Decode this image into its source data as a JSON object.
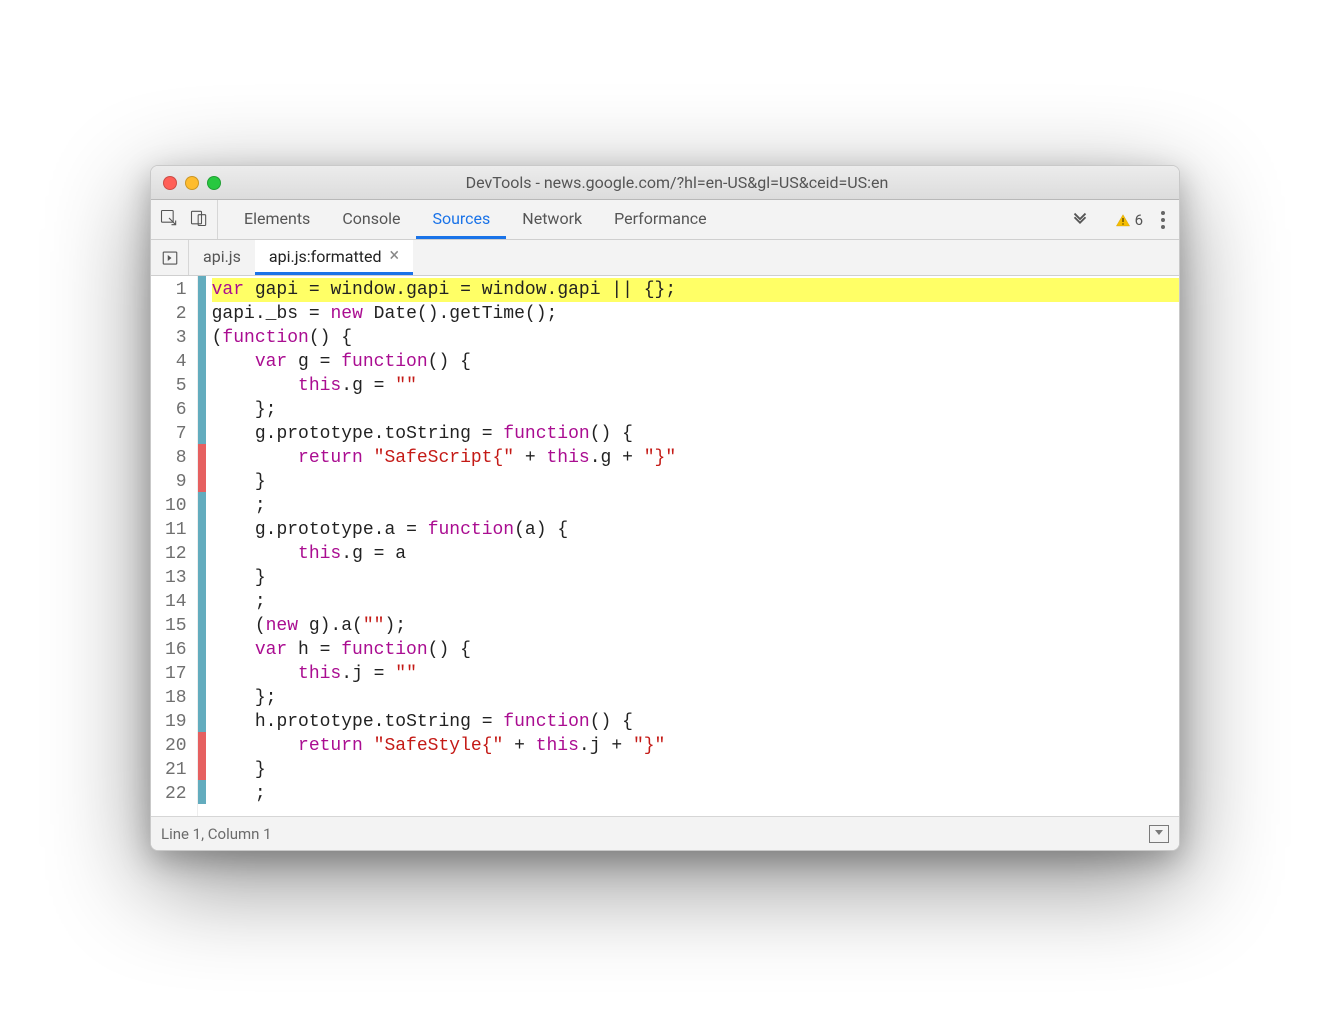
{
  "window": {
    "title": "DevTools - news.google.com/?hl=en-US&gl=US&ceid=US:en"
  },
  "toolbar": {
    "tabs": [
      "Elements",
      "Console",
      "Sources",
      "Network",
      "Performance"
    ],
    "active_tab_index": 2,
    "warning_count": "6"
  },
  "filetabs": {
    "items": [
      {
        "label": "api.js",
        "closable": false
      },
      {
        "label": "api.js:formatted",
        "closable": true
      }
    ],
    "active_index": 1
  },
  "code": {
    "lines": [
      {
        "n": 1,
        "cov": "b",
        "hl": true,
        "tokens": [
          [
            "kw",
            "var"
          ],
          [
            "pun",
            " gapi "
          ],
          [
            "pun",
            "= "
          ],
          [
            "pun",
            "window"
          ],
          [
            "pun",
            "."
          ],
          [
            "pun",
            "gapi "
          ],
          [
            "pun",
            "= "
          ],
          [
            "pun",
            "window"
          ],
          [
            "pun",
            "."
          ],
          [
            "pun",
            "gapi "
          ],
          [
            "pun",
            "|| "
          ],
          [
            "pun",
            "{};"
          ]
        ]
      },
      {
        "n": 2,
        "cov": "b",
        "tokens": [
          [
            "pun",
            "gapi"
          ],
          [
            "pun",
            "."
          ],
          [
            "pun",
            "_bs "
          ],
          [
            "pun",
            "= "
          ],
          [
            "kw",
            "new"
          ],
          [
            "pun",
            " Date"
          ],
          [
            "pun",
            "()."
          ],
          [
            "pun",
            "getTime"
          ],
          [
            "pun",
            "();"
          ]
        ]
      },
      {
        "n": 3,
        "cov": "b",
        "tokens": [
          [
            "pun",
            "("
          ],
          [
            "kw",
            "function"
          ],
          [
            "pun",
            "() {"
          ]
        ]
      },
      {
        "n": 4,
        "cov": "b",
        "tokens": [
          [
            "pun",
            "    "
          ],
          [
            "kw",
            "var"
          ],
          [
            "pun",
            " g "
          ],
          [
            "pun",
            "= "
          ],
          [
            "kw",
            "function"
          ],
          [
            "pun",
            "() {"
          ]
        ]
      },
      {
        "n": 5,
        "cov": "b",
        "tokens": [
          [
            "pun",
            "        "
          ],
          [
            "kw",
            "this"
          ],
          [
            "pun",
            "."
          ],
          [
            "pun",
            "g "
          ],
          [
            "pun",
            "= "
          ],
          [
            "str",
            "\"\""
          ]
        ]
      },
      {
        "n": 6,
        "cov": "b",
        "tokens": [
          [
            "pun",
            "    };"
          ]
        ]
      },
      {
        "n": 7,
        "cov": "b",
        "tokens": [
          [
            "pun",
            "    g"
          ],
          [
            "pun",
            "."
          ],
          [
            "pun",
            "prototype"
          ],
          [
            "pun",
            "."
          ],
          [
            "pun",
            "toString "
          ],
          [
            "pun",
            "= "
          ],
          [
            "kw",
            "function"
          ],
          [
            "pun",
            "() {"
          ]
        ]
      },
      {
        "n": 8,
        "cov": "r",
        "tokens": [
          [
            "pun",
            "        "
          ],
          [
            "kw",
            "return"
          ],
          [
            "pun",
            " "
          ],
          [
            "str",
            "\"SafeScript{\""
          ],
          [
            "pun",
            " + "
          ],
          [
            "kw",
            "this"
          ],
          [
            "pun",
            "."
          ],
          [
            "pun",
            "g "
          ],
          [
            "pun",
            "+ "
          ],
          [
            "str",
            "\"}\""
          ]
        ]
      },
      {
        "n": 9,
        "cov": "r",
        "tokens": [
          [
            "pun",
            "    }"
          ]
        ]
      },
      {
        "n": 10,
        "cov": "b",
        "tokens": [
          [
            "pun",
            "    ;"
          ]
        ]
      },
      {
        "n": 11,
        "cov": "b",
        "tokens": [
          [
            "pun",
            "    g"
          ],
          [
            "pun",
            "."
          ],
          [
            "pun",
            "prototype"
          ],
          [
            "pun",
            "."
          ],
          [
            "pun",
            "a "
          ],
          [
            "pun",
            "= "
          ],
          [
            "kw",
            "function"
          ],
          [
            "pun",
            "(a) {"
          ]
        ]
      },
      {
        "n": 12,
        "cov": "b",
        "tokens": [
          [
            "pun",
            "        "
          ],
          [
            "kw",
            "this"
          ],
          [
            "pun",
            "."
          ],
          [
            "pun",
            "g "
          ],
          [
            "pun",
            "= a"
          ]
        ]
      },
      {
        "n": 13,
        "cov": "b",
        "tokens": [
          [
            "pun",
            "    }"
          ]
        ]
      },
      {
        "n": 14,
        "cov": "b",
        "tokens": [
          [
            "pun",
            "    ;"
          ]
        ]
      },
      {
        "n": 15,
        "cov": "b",
        "tokens": [
          [
            "pun",
            "    ("
          ],
          [
            "kw",
            "new"
          ],
          [
            "pun",
            " g)."
          ],
          [
            "pun",
            "a("
          ],
          [
            "str",
            "\"\""
          ],
          [
            "pun",
            ");"
          ]
        ]
      },
      {
        "n": 16,
        "cov": "b",
        "tokens": [
          [
            "pun",
            "    "
          ],
          [
            "kw",
            "var"
          ],
          [
            "pun",
            " h "
          ],
          [
            "pun",
            "= "
          ],
          [
            "kw",
            "function"
          ],
          [
            "pun",
            "() {"
          ]
        ]
      },
      {
        "n": 17,
        "cov": "b",
        "tokens": [
          [
            "pun",
            "        "
          ],
          [
            "kw",
            "this"
          ],
          [
            "pun",
            "."
          ],
          [
            "pun",
            "j "
          ],
          [
            "pun",
            "= "
          ],
          [
            "str",
            "\"\""
          ]
        ]
      },
      {
        "n": 18,
        "cov": "b",
        "tokens": [
          [
            "pun",
            "    };"
          ]
        ]
      },
      {
        "n": 19,
        "cov": "b",
        "tokens": [
          [
            "pun",
            "    h"
          ],
          [
            "pun",
            "."
          ],
          [
            "pun",
            "prototype"
          ],
          [
            "pun",
            "."
          ],
          [
            "pun",
            "toString "
          ],
          [
            "pun",
            "= "
          ],
          [
            "kw",
            "function"
          ],
          [
            "pun",
            "() {"
          ]
        ]
      },
      {
        "n": 20,
        "cov": "r",
        "tokens": [
          [
            "pun",
            "        "
          ],
          [
            "kw",
            "return"
          ],
          [
            "pun",
            " "
          ],
          [
            "str",
            "\"SafeStyle{\""
          ],
          [
            "pun",
            " + "
          ],
          [
            "kw",
            "this"
          ],
          [
            "pun",
            "."
          ],
          [
            "pun",
            "j "
          ],
          [
            "pun",
            "+ "
          ],
          [
            "str",
            "\"}\""
          ]
        ]
      },
      {
        "n": 21,
        "cov": "r",
        "tokens": [
          [
            "pun",
            "    }"
          ]
        ]
      },
      {
        "n": 22,
        "cov": "b",
        "tokens": [
          [
            "pun",
            "    ;"
          ]
        ]
      }
    ]
  },
  "status": {
    "text": "Line 1, Column 1"
  }
}
